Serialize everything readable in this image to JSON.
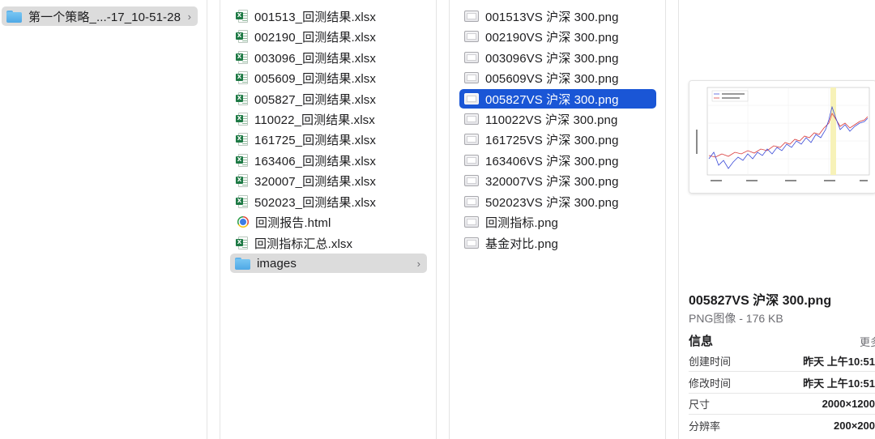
{
  "sidebar": {
    "folder_label": "第一个策略_...-17_10-51-28"
  },
  "files_column": {
    "items": [
      {
        "name": "001513_回测结果.xlsx",
        "icon": "xlsx-icon"
      },
      {
        "name": "002190_回测结果.xlsx",
        "icon": "xlsx-icon"
      },
      {
        "name": "003096_回测结果.xlsx",
        "icon": "xlsx-icon"
      },
      {
        "name": "005609_回测结果.xlsx",
        "icon": "xlsx-icon"
      },
      {
        "name": "005827_回测结果.xlsx",
        "icon": "xlsx-icon"
      },
      {
        "name": "110022_回测结果.xlsx",
        "icon": "xlsx-icon"
      },
      {
        "name": "161725_回测结果.xlsx",
        "icon": "xlsx-icon"
      },
      {
        "name": "163406_回测结果.xlsx",
        "icon": "xlsx-icon"
      },
      {
        "name": "320007_回测结果.xlsx",
        "icon": "xlsx-icon"
      },
      {
        "name": "502023_回测结果.xlsx",
        "icon": "xlsx-icon"
      },
      {
        "name": "回测报告.html",
        "icon": "chrome-icon"
      },
      {
        "name": "回测指标汇总.xlsx",
        "icon": "xlsx-icon"
      },
      {
        "name": "images",
        "icon": "folder-icon"
      }
    ]
  },
  "images_column": {
    "items": [
      {
        "name": "001513VS 沪深 300.png"
      },
      {
        "name": "002190VS 沪深 300.png"
      },
      {
        "name": "003096VS 沪深 300.png"
      },
      {
        "name": "005609VS 沪深 300.png"
      },
      {
        "name": "005827VS 沪深 300.png"
      },
      {
        "name": "110022VS 沪深 300.png"
      },
      {
        "name": "161725VS 沪深 300.png"
      },
      {
        "name": "163406VS 沪深 300.png"
      },
      {
        "name": "320007VS 沪深 300.png"
      },
      {
        "name": "502023VS 沪深 300.png"
      },
      {
        "name": "回测指标.png"
      },
      {
        "name": "基金对比.png"
      }
    ]
  },
  "preview": {
    "title": "005827VS 沪深 300.png",
    "subtitle": "PNG图像 - 176 KB",
    "info_heading": "信息",
    "more_label": "更多",
    "info": [
      {
        "label": "创建时间",
        "value": "昨天 上午10:51"
      },
      {
        "label": "修改时间",
        "value": "昨天 上午10:51"
      },
      {
        "label": "尺寸",
        "value": "2000×1200"
      },
      {
        "label": "分辨率",
        "value": "200×200"
      }
    ]
  },
  "colors": {
    "selection_blue": "#1a56d6",
    "selection_gray": "#dcdcdc",
    "excel_green": "#1e7a45",
    "folder_blue": "#5bb4ee"
  }
}
